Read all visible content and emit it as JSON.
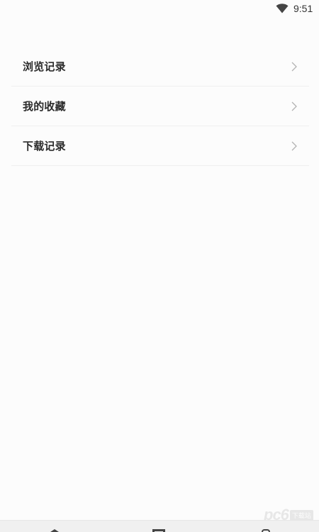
{
  "status_bar": {
    "time": "9:51",
    "icons": [
      "wifi-icon"
    ]
  },
  "menu": {
    "items": [
      {
        "label": "浏览记录",
        "icon": "chevron-right-icon"
      },
      {
        "label": "我的收藏",
        "icon": "chevron-right-icon"
      },
      {
        "label": "下载记录",
        "icon": "chevron-right-icon"
      }
    ]
  },
  "nav_bar": {
    "icons": [
      "back-icon",
      "home-icon",
      "recent-apps-icon"
    ]
  },
  "watermark": {
    "text": "pc6",
    "badge": "下载站"
  },
  "colors": {
    "background": "#fcfcfc",
    "label": "#2b2b2b",
    "divider": "#efefef",
    "chevron": "#b3b3b3"
  }
}
